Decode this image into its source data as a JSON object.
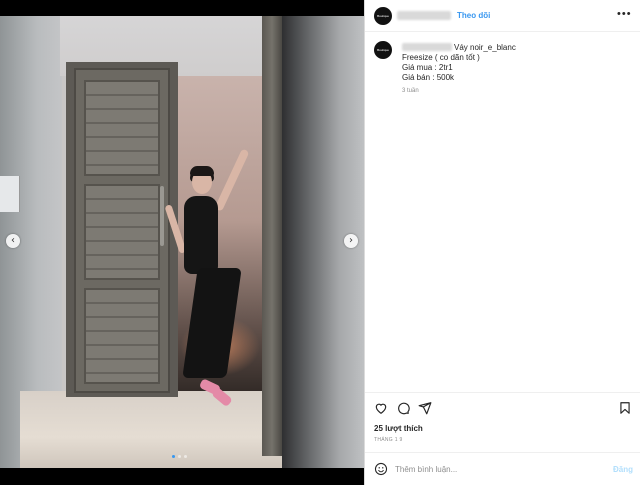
{
  "post": {
    "follow_label": "Theo dõi",
    "more_label": "•••",
    "avatar_text": "Boutique",
    "caption": {
      "first_line": "Váy noir_e_blanc",
      "lines": [
        "Freesize ( co dãn tốt )",
        "Giá mua : 2tr1",
        "Giá bán : 500k"
      ]
    },
    "time_ago": "3 tuần",
    "likes": "25 lượt thích",
    "date": "THÁNG 1 9"
  },
  "comment": {
    "placeholder": "Thêm bình luận...",
    "post_label": "Đăng"
  },
  "media": {
    "prev_icon": "‹",
    "next_icon": "›",
    "slide_count": 3,
    "active_slide": 1
  },
  "icons": {
    "like": "heart-icon",
    "comment": "comment-icon",
    "share": "share-icon",
    "save": "bookmark-icon",
    "emoji": "smiley-icon"
  },
  "colors": {
    "accent": "#3897f0",
    "text": "#262626",
    "muted": "#8e8e8e",
    "post_disabled": "#b2dffc"
  }
}
